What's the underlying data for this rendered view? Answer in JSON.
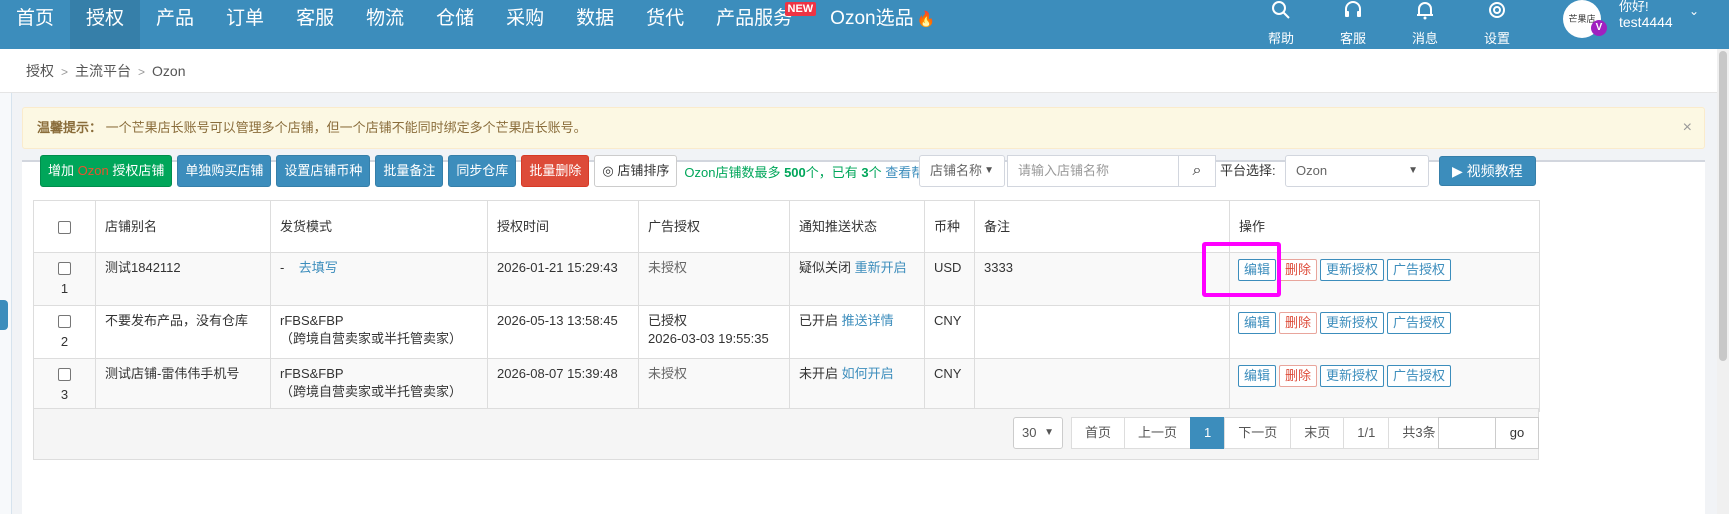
{
  "nav": {
    "items": [
      {
        "label": "首页"
      },
      {
        "label": "授权"
      },
      {
        "label": "产品"
      },
      {
        "label": "订单"
      },
      {
        "label": "客服"
      },
      {
        "label": "物流"
      },
      {
        "label": "仓储"
      },
      {
        "label": "采购"
      },
      {
        "label": "数据"
      },
      {
        "label": "货代"
      },
      {
        "label": "产品服务",
        "badge": "NEW"
      },
      {
        "label": "Ozon选品"
      }
    ],
    "active_index": 1,
    "tools": [
      {
        "label": "帮助",
        "icon": "search-icon"
      },
      {
        "label": "客服",
        "icon": "headset-icon"
      },
      {
        "label": "消息",
        "icon": "bell-icon"
      },
      {
        "label": "设置",
        "icon": "gear-icon"
      }
    ],
    "user": {
      "greeting": "你好!",
      "name": "test4444",
      "avatar_text": "芒果店",
      "vip_badge": "V"
    }
  },
  "breadcrumb": [
    "授权",
    "主流平台",
    "Ozon"
  ],
  "alert": {
    "title": "温馨提示：",
    "text": "一个芒果店长账号可以管理多个店铺，但一个店铺不能同时绑定多个芒果店长账号。",
    "close": "×"
  },
  "toolbar": {
    "add_prefix": "增加 ",
    "add_brand": "Ozon",
    "add_suffix": " 授权店铺",
    "buy": "单独购买店铺",
    "currency": "设置店铺币种",
    "batch_note": "批量备注",
    "sync_warehouse": "同步仓库",
    "batch_delete": "批量删除",
    "sort": "店铺排序",
    "tip_prefix": "Ozon店铺数最多 ",
    "tip_max": "500",
    "tip_mid": "个，已有 ",
    "tip_count": "3",
    "tip_suffix": "个 ",
    "help_link": "查看帮助文档",
    "search_field": "店铺名称",
    "search_placeholder": "请输入店铺名称",
    "platform_label": "平台选择:",
    "platform_value": "Ozon",
    "video": "视频教程"
  },
  "table": {
    "columns": [
      "店铺别名",
      "发货模式",
      "授权时间",
      "广告授权",
      "通知推送状态",
      "币种",
      "备注",
      "操作"
    ],
    "rows": [
      {
        "num": "1",
        "alias": "测试1842112",
        "mode_line1": "-",
        "mode_link": "去填写",
        "mode_line2": "",
        "auth_time": "2026-01-21 15:29:43",
        "ad_status": "未授权",
        "ad_time": "",
        "push_status": "疑似关闭",
        "push_link": "重新开启",
        "currency": "USD",
        "note": "3333"
      },
      {
        "num": "2",
        "alias": "不要发布产品，没有仓库",
        "mode_line1": "rFBS&FBP",
        "mode_link": "",
        "mode_line2": "（跨境自营卖家或半托管卖家）",
        "auth_time": "2026-05-13 13:58:45",
        "ad_status": "已授权",
        "ad_time": "2026-03-03 19:55:35",
        "push_status": "已开启",
        "push_link": "推送详情",
        "currency": "CNY",
        "note": ""
      },
      {
        "num": "3",
        "alias": "测试店铺-雷伟伟手机号",
        "mode_line1": "rFBS&FBP",
        "mode_link": "",
        "mode_line2": "（跨境自营卖家或半托管卖家）",
        "auth_time": "2026-08-07 15:39:48",
        "ad_status": "未授权",
        "ad_time": "",
        "push_status": "未开启",
        "push_link": "如何开启",
        "currency": "CNY",
        "note": ""
      }
    ],
    "actions": {
      "edit": "编辑",
      "delete": "删除",
      "reauth": "更新授权",
      "ad_auth": "广告授权"
    }
  },
  "pagination": {
    "page_size": "30",
    "first": "首页",
    "prev": "上一页",
    "current": "1",
    "next": "下一页",
    "last": "末页",
    "pages": "1/1",
    "total": "共3条",
    "go": "go"
  },
  "colors": {
    "nav_bg": "#3c8dbc",
    "highlight": "#ff00ff",
    "success": "#00a65a",
    "danger": "#dd4b39"
  }
}
